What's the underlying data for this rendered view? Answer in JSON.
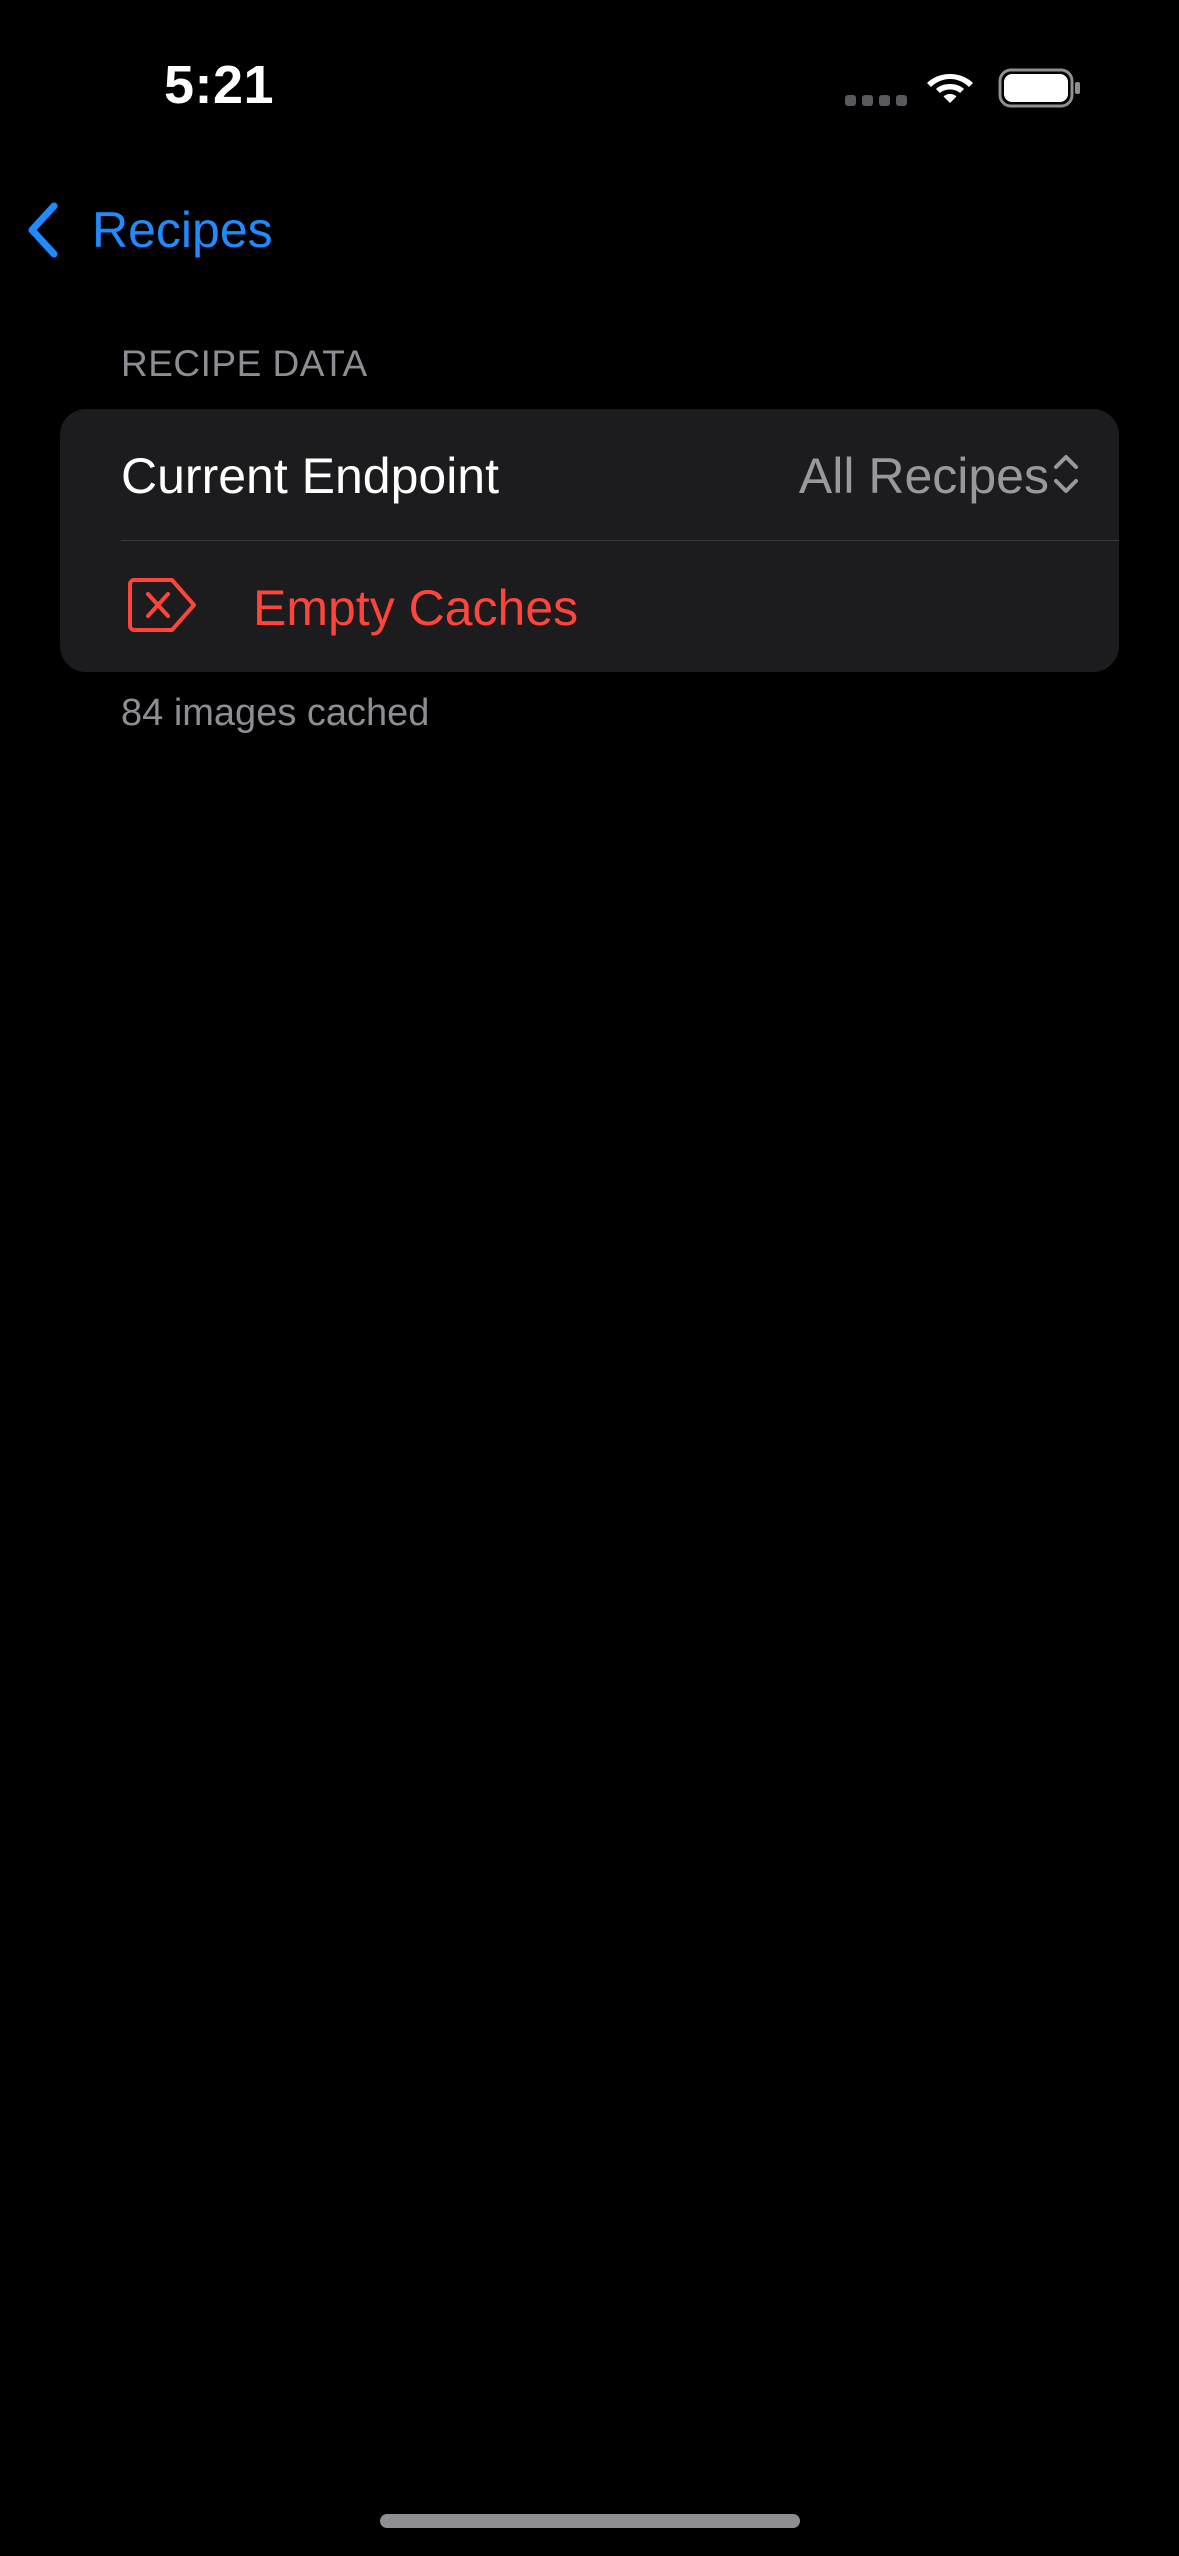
{
  "status_bar": {
    "time": "5:21",
    "icons": [
      "signal-dots-icon",
      "wifi-icon",
      "battery-icon"
    ]
  },
  "nav": {
    "back_label": "Recipes",
    "back_icon": "chevron-left-icon"
  },
  "section": {
    "header": "RECIPE DATA",
    "rows": {
      "endpoint": {
        "label": "Current Endpoint",
        "value": "All Recipes",
        "icon": "chevron-up-down-icon"
      },
      "empty_caches": {
        "label": "Empty Caches",
        "icon": "delete-backward-icon"
      }
    },
    "footer": "84 images cached"
  },
  "colors": {
    "background": "#000000",
    "group_background": "#1c1c1e",
    "accent_blue": "#1f8bff",
    "destructive_red": "#ff453a",
    "secondary_text": "#8d8d93"
  }
}
